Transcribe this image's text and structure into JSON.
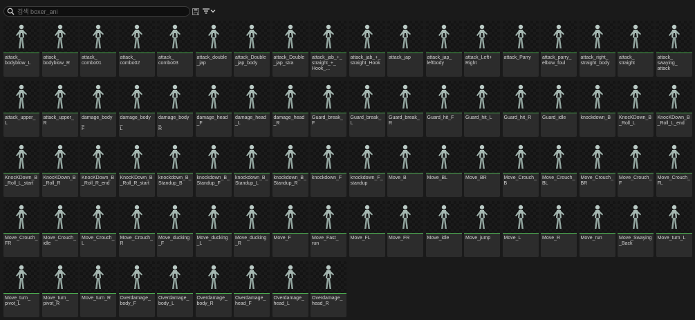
{
  "search": {
    "placeholder": "검색 boxer_ani"
  },
  "icons": {
    "search": "search-icon",
    "save": "save-icon",
    "filter": "filter-icon",
    "dropdown": "chevron-down-icon",
    "asset": "animation-figure-icon"
  },
  "colors": {
    "accent": "#4caf50",
    "tile_bg": "#2c2c2c",
    "thumb_bg": "#141414"
  },
  "assets": [
    "attack_\nbodyblow_L",
    "attack_\nbodyblow_R",
    "attack_\ncombo01",
    "attack_\ncombo02",
    "attack_\ncombo03",
    "attack_double\n_jap",
    "attack_Double\n_jap_body",
    "attack_Double\n_jap_stra",
    "attack_jab_+_\nstraight_+_\nHook_...",
    "attack_jab_+_\nstraight_Hook",
    "attack_jap",
    "attack_jap_\nleftbody",
    "attack_Left+\nRight",
    "attack_Parry",
    "attack_parry_\nelbow_foul",
    "attack_right_\nstraight_body",
    "attack_\nstraight",
    "attack_\nswaying_\nattack",
    "attack_upper_\nL",
    "attack_upper_\nR",
    "damage_body_\nF",
    "damage_body_\nL",
    "damage_body_\nR",
    "damage_head\n_F",
    "damage_head\n_L",
    "damage_head\n_R",
    "Guard_break_\nF",
    "Guard_break_\nL",
    "Guard_break_\nR",
    "Guard_hit_F",
    "Guard_hit_L",
    "Guard_hit_R",
    "Guard_idle",
    "knockdown_B",
    "KnocKDown_B\n_Roll_L",
    "KnocKDown_B\n_Roll_L_end",
    "KnocKDown_B\n_Roll_L_start",
    "KnocKDown_B\n_Roll_R",
    "KnocKDown_B\n_Roll_R_end",
    "KnocKDown_B\n_Roll_R_start",
    "knockdown_B_\nStandup_B",
    "knockdown_B_\nStandup_F",
    "knockdown_B_\nStandup_L",
    "knockdown_B_\nStandup_R",
    "knockdown_F",
    "knockdown_F_\nstandup",
    "Move_B",
    "Move_BL",
    "Move_BR",
    "Move_Crouch_\nB",
    "Move_Crouch_\nBL",
    "Move_Crouch_\nBR",
    "Move_Crouch_\nF",
    "Move_Crouch_\nFL",
    "Move_Crouch_\nFR",
    "Move_Crouch_\nidle",
    "Move_Crouch_\nL",
    "Move_Crouch_\nR",
    "Move_ducking\n_F",
    "Move_ducking\n_L",
    "Move_ducking\n_R",
    "Move_F",
    "Move_Fast_\nrun",
    "Move_FL",
    "Move_FR",
    "Move_idle",
    "Move_jump",
    "Move_L",
    "Move_R",
    "Move_run",
    "Move_Swaying\n_Back",
    "Move_turn_L",
    "Move_turn_\npivot_L",
    "Move_turn_\npivot_R",
    "Move_turn_R",
    "Overdamage_\nbody_F",
    "Overdamage_\nbody_L",
    "Overdamage_\nbody_R",
    "Overdamage_\nhead_F",
    "Overdamage_\nhead_L",
    "Overdamage_\nhead_R"
  ]
}
